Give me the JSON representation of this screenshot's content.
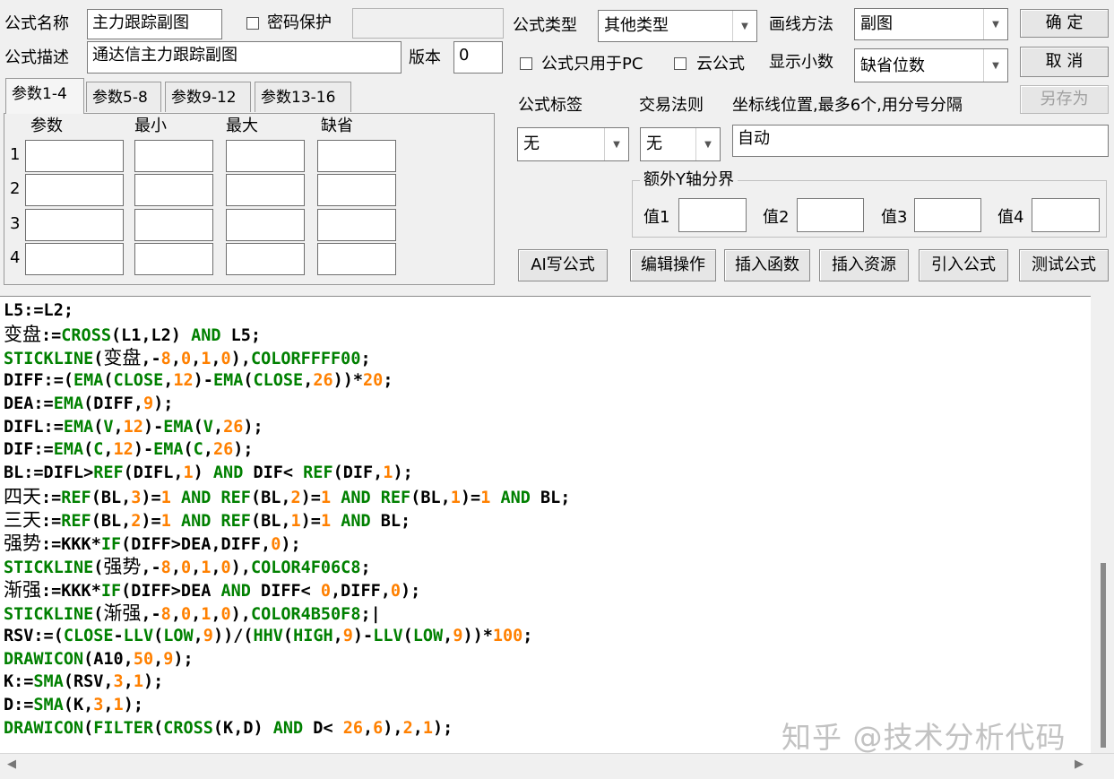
{
  "form": {
    "name_label": "公式名称",
    "name_value": "主力跟踪副图",
    "password_label": "密码保护",
    "desc_label": "公式描述",
    "desc_value": "通达信主力跟踪副图",
    "version_label": "版本",
    "version_value": "0",
    "type_label": "公式类型",
    "type_value": "其他类型",
    "draw_label": "画线方法",
    "draw_value": "副图",
    "pc_only_label": "公式只用于PC",
    "cloud_label": "云公式",
    "decimals_label": "显示小数",
    "decimals_value": "缺省位数",
    "tag_label": "公式标签",
    "tag_value": "无",
    "rule_label": "交易法则",
    "rule_value": "无",
    "axis_label": "坐标线位置,最多6个,用分号分隔",
    "axis_value": "自动",
    "extra_y_label": "额外Y轴分界",
    "y_values": [
      "值1",
      "值2",
      "值3",
      "值4"
    ]
  },
  "buttons": {
    "ok": "确 定",
    "cancel": "取 消",
    "save_as": "另存为",
    "ai": "AI写公式",
    "edit": "编辑操作",
    "insert_func": "插入函数",
    "insert_res": "插入资源",
    "import": "引入公式",
    "test": "测试公式"
  },
  "tabs": [
    "参数1-4",
    "参数5-8",
    "参数9-12",
    "参数13-16"
  ],
  "params": {
    "headers": [
      "参数",
      "最小",
      "最大",
      "缺省"
    ],
    "rows": [
      "1",
      "2",
      "3",
      "4"
    ]
  },
  "code_lines": [
    [
      [
        "L5:=L2;",
        "#000000"
      ]
    ],
    [
      [
        "变盘",
        "#000000",
        "cjk"
      ],
      [
        ":=",
        "#000000"
      ],
      [
        "CROSS",
        "#008000"
      ],
      [
        "(L1,L2) ",
        "#000000"
      ],
      [
        "AND",
        "#008000"
      ],
      [
        " L5;",
        "#000000"
      ]
    ],
    [
      [
        "STICKLINE",
        "#008000"
      ],
      [
        "(",
        "#000000"
      ],
      [
        "变盘",
        "#000000",
        "cjk"
      ],
      [
        ",-",
        "#000000"
      ],
      [
        "8",
        "#ff8000"
      ],
      [
        ",",
        "#000000"
      ],
      [
        "0",
        "#ff8000"
      ],
      [
        ",",
        "#000000"
      ],
      [
        "1",
        "#ff8000"
      ],
      [
        ",",
        "#000000"
      ],
      [
        "0",
        "#ff8000"
      ],
      [
        "),",
        "#000000"
      ],
      [
        "COLORFFFF00",
        "#008000"
      ],
      [
        ";",
        "#000000"
      ]
    ],
    [
      [
        "DIFF:=(",
        "#000000"
      ],
      [
        "EMA",
        "#008000"
      ],
      [
        "(",
        "#000000"
      ],
      [
        "CLOSE",
        "#008000"
      ],
      [
        ",",
        "#000000"
      ],
      [
        "12",
        "#ff8000"
      ],
      [
        ")-",
        "#000000"
      ],
      [
        "EMA",
        "#008000"
      ],
      [
        "(",
        "#000000"
      ],
      [
        "CLOSE",
        "#008000"
      ],
      [
        ",",
        "#000000"
      ],
      [
        "26",
        "#ff8000"
      ],
      [
        "))*",
        "#000000"
      ],
      [
        "20",
        "#ff8000"
      ],
      [
        ";",
        "#000000"
      ]
    ],
    [
      [
        "DEA:=",
        "#000000"
      ],
      [
        "EMA",
        "#008000"
      ],
      [
        "(DIFF,",
        "#000000"
      ],
      [
        "9",
        "#ff8000"
      ],
      [
        ");",
        "#000000"
      ]
    ],
    [
      [
        "DIFL:=",
        "#000000"
      ],
      [
        "EMA",
        "#008000"
      ],
      [
        "(",
        "#000000"
      ],
      [
        "V",
        "#008000"
      ],
      [
        ",",
        "#000000"
      ],
      [
        "12",
        "#ff8000"
      ],
      [
        ")-",
        "#000000"
      ],
      [
        "EMA",
        "#008000"
      ],
      [
        "(",
        "#000000"
      ],
      [
        "V",
        "#008000"
      ],
      [
        ",",
        "#000000"
      ],
      [
        "26",
        "#ff8000"
      ],
      [
        ");",
        "#000000"
      ]
    ],
    [
      [
        "DIF:=",
        "#000000"
      ],
      [
        "EMA",
        "#008000"
      ],
      [
        "(",
        "#000000"
      ],
      [
        "C",
        "#008000"
      ],
      [
        ",",
        "#000000"
      ],
      [
        "12",
        "#ff8000"
      ],
      [
        ")-",
        "#000000"
      ],
      [
        "EMA",
        "#008000"
      ],
      [
        "(",
        "#000000"
      ],
      [
        "C",
        "#008000"
      ],
      [
        ",",
        "#000000"
      ],
      [
        "26",
        "#ff8000"
      ],
      [
        ");",
        "#000000"
      ]
    ],
    [
      [
        "BL:=DIFL>",
        "#000000"
      ],
      [
        "REF",
        "#008000"
      ],
      [
        "(DIFL,",
        "#000000"
      ],
      [
        "1",
        "#ff8000"
      ],
      [
        ") ",
        "#000000"
      ],
      [
        "AND",
        "#008000"
      ],
      [
        " DIF< ",
        "#000000"
      ],
      [
        "REF",
        "#008000"
      ],
      [
        "(DIF,",
        "#000000"
      ],
      [
        "1",
        "#ff8000"
      ],
      [
        ");",
        "#000000"
      ]
    ],
    [
      [
        "四天",
        "#000000",
        "cjk"
      ],
      [
        ":=",
        "#000000"
      ],
      [
        "REF",
        "#008000"
      ],
      [
        "(BL,",
        "#000000"
      ],
      [
        "3",
        "#ff8000"
      ],
      [
        ")=",
        "#000000"
      ],
      [
        "1",
        "#ff8000"
      ],
      [
        " ",
        "#000000"
      ],
      [
        "AND",
        "#008000"
      ],
      [
        " ",
        "#000000"
      ],
      [
        "REF",
        "#008000"
      ],
      [
        "(BL,",
        "#000000"
      ],
      [
        "2",
        "#ff8000"
      ],
      [
        ")=",
        "#000000"
      ],
      [
        "1",
        "#ff8000"
      ],
      [
        " ",
        "#000000"
      ],
      [
        "AND",
        "#008000"
      ],
      [
        " ",
        "#000000"
      ],
      [
        "REF",
        "#008000"
      ],
      [
        "(BL,",
        "#000000"
      ],
      [
        "1",
        "#ff8000"
      ],
      [
        ")=",
        "#000000"
      ],
      [
        "1",
        "#ff8000"
      ],
      [
        " ",
        "#000000"
      ],
      [
        "AND",
        "#008000"
      ],
      [
        " BL;",
        "#000000"
      ]
    ],
    [
      [
        "三天",
        "#000000",
        "cjk"
      ],
      [
        ":=",
        "#000000"
      ],
      [
        "REF",
        "#008000"
      ],
      [
        "(BL,",
        "#000000"
      ],
      [
        "2",
        "#ff8000"
      ],
      [
        ")=",
        "#000000"
      ],
      [
        "1",
        "#ff8000"
      ],
      [
        " ",
        "#000000"
      ],
      [
        "AND",
        "#008000"
      ],
      [
        " ",
        "#000000"
      ],
      [
        "REF",
        "#008000"
      ],
      [
        "(BL,",
        "#000000"
      ],
      [
        "1",
        "#ff8000"
      ],
      [
        ")=",
        "#000000"
      ],
      [
        "1",
        "#ff8000"
      ],
      [
        " ",
        "#000000"
      ],
      [
        "AND",
        "#008000"
      ],
      [
        " BL;",
        "#000000"
      ]
    ],
    [
      [
        "强势",
        "#000000",
        "cjk"
      ],
      [
        ":=KKK*",
        "#000000"
      ],
      [
        "IF",
        "#008000"
      ],
      [
        "(DIFF>DEA,DIFF,",
        "#000000"
      ],
      [
        "0",
        "#ff8000"
      ],
      [
        ");",
        "#000000"
      ]
    ],
    [
      [
        "STICKLINE",
        "#008000"
      ],
      [
        "(",
        "#000000"
      ],
      [
        "强势",
        "#000000",
        "cjk"
      ],
      [
        ",-",
        "#000000"
      ],
      [
        "8",
        "#ff8000"
      ],
      [
        ",",
        "#000000"
      ],
      [
        "0",
        "#ff8000"
      ],
      [
        ",",
        "#000000"
      ],
      [
        "1",
        "#ff8000"
      ],
      [
        ",",
        "#000000"
      ],
      [
        "0",
        "#ff8000"
      ],
      [
        "),",
        "#000000"
      ],
      [
        "COLOR4F06C8",
        "#008000"
      ],
      [
        ";",
        "#000000"
      ]
    ],
    [
      [
        "渐强",
        "#000000",
        "cjk"
      ],
      [
        ":=KKK*",
        "#000000"
      ],
      [
        "IF",
        "#008000"
      ],
      [
        "(DIFF>DEA ",
        "#000000"
      ],
      [
        "AND",
        "#008000"
      ],
      [
        " DIFF< ",
        "#000000"
      ],
      [
        "0",
        "#ff8000"
      ],
      [
        ",DIFF,",
        "#000000"
      ],
      [
        "0",
        "#ff8000"
      ],
      [
        ");",
        "#000000"
      ]
    ],
    [
      [
        "STICKLINE",
        "#008000"
      ],
      [
        "(",
        "#000000"
      ],
      [
        "渐强",
        "#000000",
        "cjk"
      ],
      [
        ",-",
        "#000000"
      ],
      [
        "8",
        "#ff8000"
      ],
      [
        ",",
        "#000000"
      ],
      [
        "0",
        "#ff8000"
      ],
      [
        ",",
        "#000000"
      ],
      [
        "1",
        "#ff8000"
      ],
      [
        ",",
        "#000000"
      ],
      [
        "0",
        "#ff8000"
      ],
      [
        "),",
        "#000000"
      ],
      [
        "COLOR4B50F8",
        "#008000"
      ],
      [
        ";|",
        "#000000"
      ]
    ],
    [
      [
        "RSV:=(",
        "#000000"
      ],
      [
        "CLOSE",
        "#008000"
      ],
      [
        "-",
        "#000000"
      ],
      [
        "LLV",
        "#008000"
      ],
      [
        "(",
        "#000000"
      ],
      [
        "LOW",
        "#008000"
      ],
      [
        ",",
        "#000000"
      ],
      [
        "9",
        "#ff8000"
      ],
      [
        "))/(",
        "#000000"
      ],
      [
        "HHV",
        "#008000"
      ],
      [
        "(",
        "#000000"
      ],
      [
        "HIGH",
        "#008000"
      ],
      [
        ",",
        "#000000"
      ],
      [
        "9",
        "#ff8000"
      ],
      [
        ")-",
        "#000000"
      ],
      [
        "LLV",
        "#008000"
      ],
      [
        "(",
        "#000000"
      ],
      [
        "LOW",
        "#008000"
      ],
      [
        ",",
        "#000000"
      ],
      [
        "9",
        "#ff8000"
      ],
      [
        "))*",
        "#000000"
      ],
      [
        "100",
        "#ff8000"
      ],
      [
        ";",
        "#000000"
      ]
    ],
    [
      [
        "DRAWICON",
        "#008000"
      ],
      [
        "(A10,",
        "#000000"
      ],
      [
        "50",
        "#ff8000"
      ],
      [
        ",",
        "#000000"
      ],
      [
        "9",
        "#ff8000"
      ],
      [
        ");",
        "#000000"
      ]
    ],
    [
      [
        "K:=",
        "#000000"
      ],
      [
        "SMA",
        "#008000"
      ],
      [
        "(RSV,",
        "#000000"
      ],
      [
        "3",
        "#ff8000"
      ],
      [
        ",",
        "#000000"
      ],
      [
        "1",
        "#ff8000"
      ],
      [
        ");",
        "#000000"
      ]
    ],
    [
      [
        "D:=",
        "#000000"
      ],
      [
        "SMA",
        "#008000"
      ],
      [
        "(K,",
        "#000000"
      ],
      [
        "3",
        "#ff8000"
      ],
      [
        ",",
        "#000000"
      ],
      [
        "1",
        "#ff8000"
      ],
      [
        ");",
        "#000000"
      ]
    ],
    [
      [
        "DRAWICON",
        "#008000"
      ],
      [
        "(",
        "#000000"
      ],
      [
        "FILTER",
        "#008000"
      ],
      [
        "(",
        "#000000"
      ],
      [
        "CROSS",
        "#008000"
      ],
      [
        "(K,D) ",
        "#000000"
      ],
      [
        "AND",
        "#008000"
      ],
      [
        " D< ",
        "#000000"
      ],
      [
        "26",
        "#ff8000"
      ],
      [
        ",",
        "#000000"
      ],
      [
        "6",
        "#ff8000"
      ],
      [
        "),",
        "#000000"
      ],
      [
        "2",
        "#ff8000"
      ],
      [
        ",",
        "#000000"
      ],
      [
        "1",
        "#ff8000"
      ],
      [
        ");",
        "#000000"
      ]
    ]
  ],
  "watermark": "知乎 @技术分析代码",
  "colors": {
    "keyword": "#008000",
    "number": "#ff8000",
    "text": "#000000"
  }
}
